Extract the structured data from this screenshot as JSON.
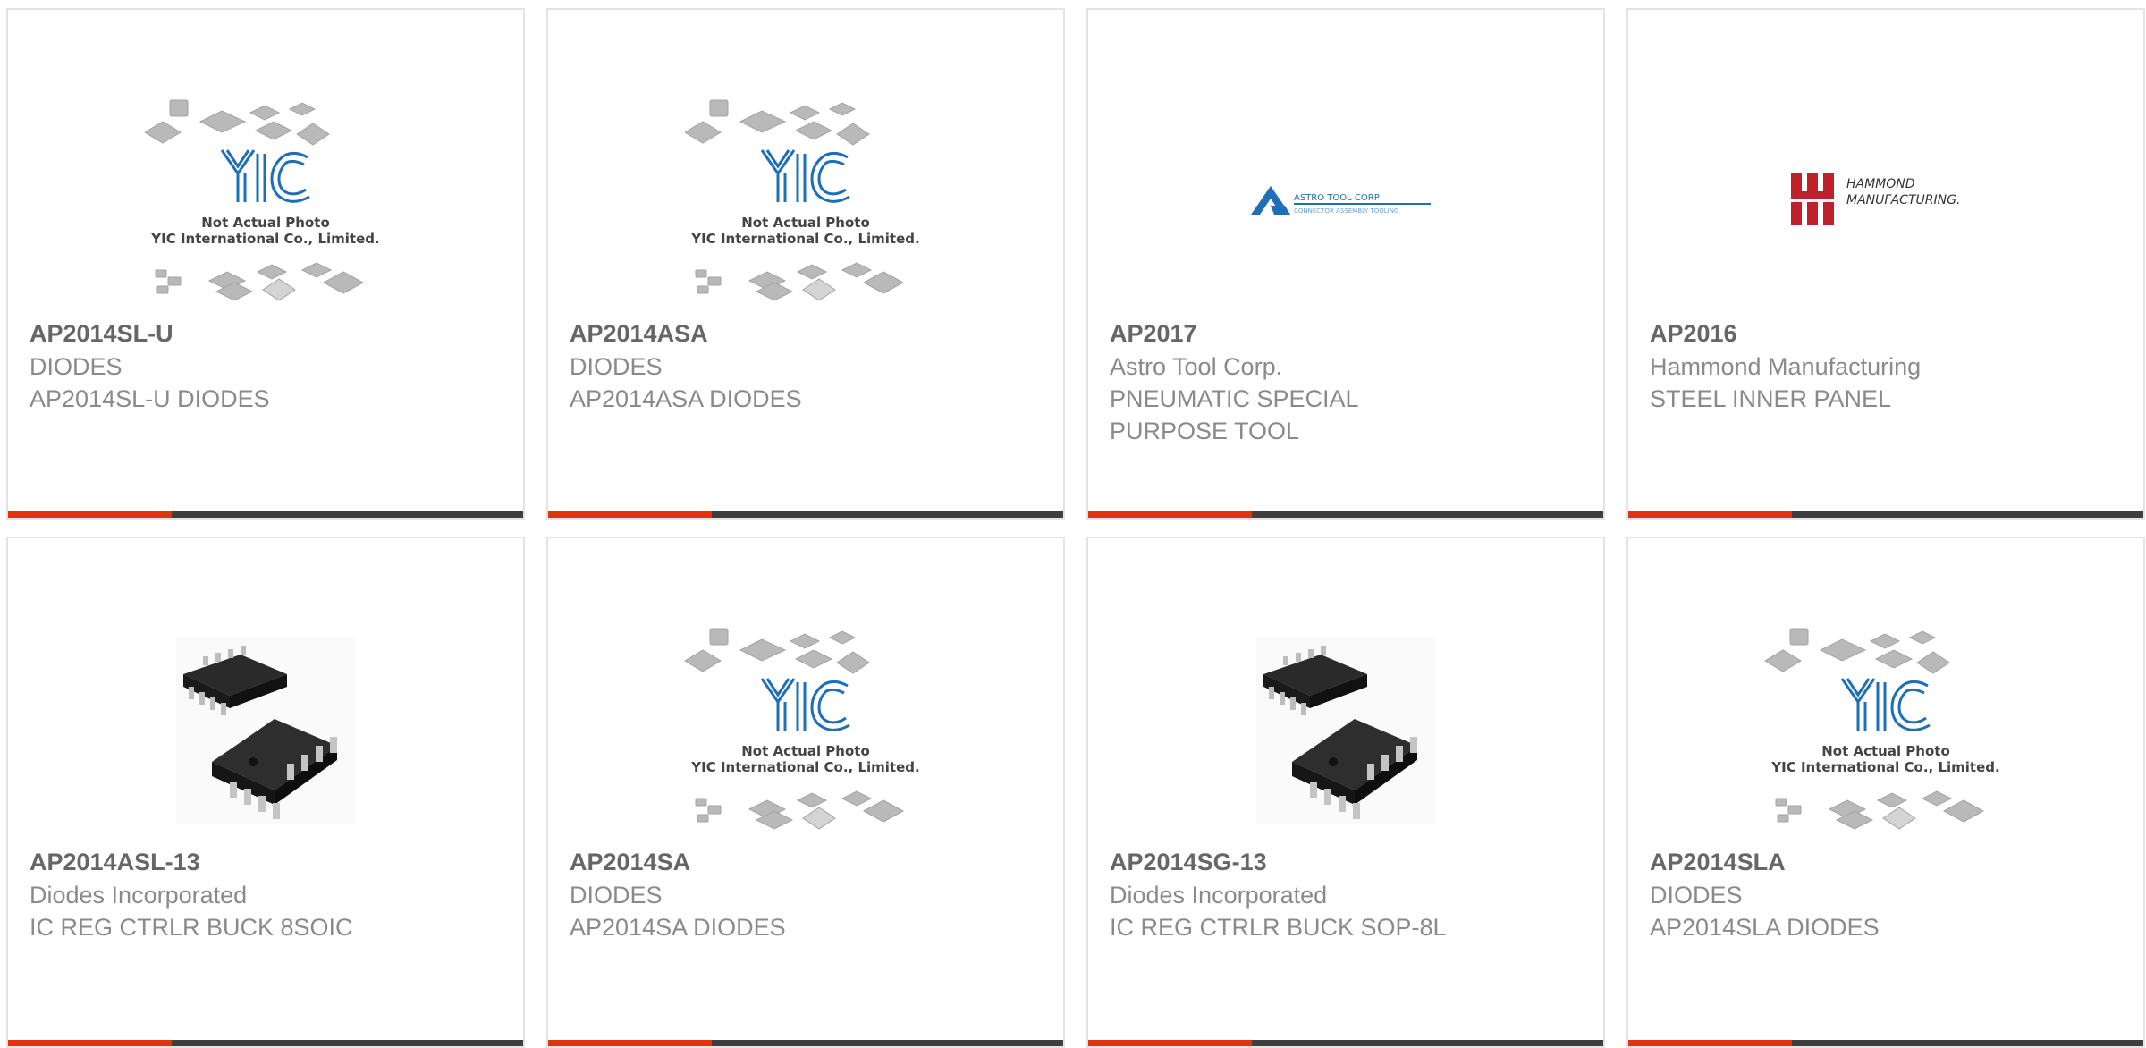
{
  "placeholder_image": {
    "caption_line1": "Not Actual Photo",
    "caption_line2": "YIC International Co., Limited.",
    "logo_text": "YIC"
  },
  "brand_logos": {
    "astro_line1": "ASTRO TOOL CORP",
    "astro_line2": "CONNECTOR ASSEMBLY TOOLING",
    "hammond_line1": "HAMMOND",
    "hammond_line2": "MANUFACTURING."
  },
  "colors": {
    "accent": "#e0330e",
    "bar_dark": "#3e3e3e",
    "yic_blue": "#1e6fb8"
  },
  "products": [
    {
      "part_number": "AP2014SL-U",
      "manufacturer": "DIODES",
      "description": "AP2014SL-U DIODES",
      "image": "yic-placeholder"
    },
    {
      "part_number": "AP2014ASA",
      "manufacturer": "DIODES",
      "description": "AP2014ASA DIODES",
      "image": "yic-placeholder"
    },
    {
      "part_number": "AP2017",
      "manufacturer": "Astro Tool Corp.",
      "description": "PNEUMATIC SPECIAL PURPOSE TOOL",
      "image": "astro-tool-logo"
    },
    {
      "part_number": "AP2016",
      "manufacturer": "Hammond Manufacturing",
      "description": "STEEL INNER PANEL",
      "image": "hammond-logo"
    },
    {
      "part_number": "AP2014ASL-13",
      "manufacturer": "Diodes Incorporated",
      "description": "IC REG CTRLR BUCK 8SOIC",
      "image": "soic-chip-photo"
    },
    {
      "part_number": "AP2014SA",
      "manufacturer": "DIODES",
      "description": "AP2014SA DIODES",
      "image": "yic-placeholder"
    },
    {
      "part_number": "AP2014SG-13",
      "manufacturer": "Diodes Incorporated",
      "description": "IC REG CTRLR BUCK SOP-8L",
      "image": "soic-chip-photo"
    },
    {
      "part_number": "AP2014SLA",
      "manufacturer": "DIODES",
      "description": "AP2014SLA DIODES",
      "image": "yic-placeholder"
    }
  ]
}
